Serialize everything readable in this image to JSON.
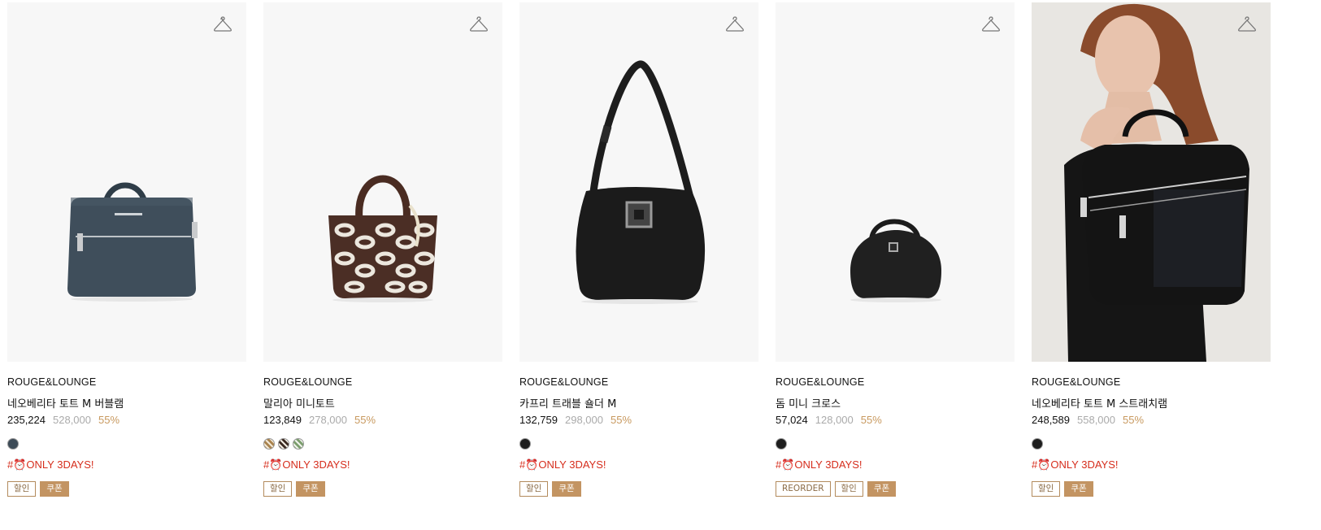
{
  "products": [
    {
      "brand": "ROUGE&LOUNGE",
      "name": "네오베리타 토트 M 버블램",
      "sale_price": "235,224",
      "original_price": "528,000",
      "discount": "55%",
      "swatch_colors": [
        "#3d4b57"
      ],
      "promo": "#⏰ONLY 3DAYS!",
      "tags": [
        {
          "label": "할인",
          "type": "discount"
        },
        {
          "label": "쿠폰",
          "type": "coupon"
        }
      ],
      "image": "navy-pebbled-leather-tote"
    },
    {
      "brand": "ROUGE&LOUNGE",
      "name": "말리아 미니토트",
      "sale_price": "123,849",
      "original_price": "278,000",
      "discount": "55%",
      "swatch_colors": [
        "#a9834e",
        "#3b2a22",
        "#7c9e6e"
      ],
      "promo": "#⏰ONLY 3DAYS!",
      "tags": [
        {
          "label": "할인",
          "type": "discount"
        },
        {
          "label": "쿠폰",
          "type": "coupon"
        }
      ],
      "image": "brown-chain-pattern-mini-tote"
    },
    {
      "brand": "ROUGE&LOUNGE",
      "name": "카프리 트래블 숄더 M",
      "sale_price": "132,759",
      "original_price": "298,000",
      "discount": "55%",
      "swatch_colors": [
        "#1e1e1e"
      ],
      "promo": "#⏰ONLY 3DAYS!",
      "tags": [
        {
          "label": "할인",
          "type": "discount"
        },
        {
          "label": "쿠폰",
          "type": "coupon"
        }
      ],
      "image": "black-nylon-shoulder-bag"
    },
    {
      "brand": "ROUGE&LOUNGE",
      "name": "돔 미니 크로스",
      "sale_price": "57,024",
      "original_price": "128,000",
      "discount": "55%",
      "swatch_colors": [
        "#1e1e1e"
      ],
      "promo": "#⏰ONLY 3DAYS!",
      "tags": [
        {
          "label": "REORDER",
          "type": "reorder"
        },
        {
          "label": "할인",
          "type": "discount"
        },
        {
          "label": "쿠폰",
          "type": "coupon"
        }
      ],
      "image": "black-dome-mini-crossbody"
    },
    {
      "brand": "ROUGE&LOUNGE",
      "name": "네오베리타 토트 M 스트래치램",
      "sale_price": "248,589",
      "original_price": "558,000",
      "discount": "55%",
      "swatch_colors": [
        "#1e1e1e"
      ],
      "promo": "#⏰ONLY 3DAYS!",
      "tags": [
        {
          "label": "할인",
          "type": "discount"
        },
        {
          "label": "쿠폰",
          "type": "coupon"
        }
      ],
      "image": "model-holding-black-quilted-tote"
    }
  ],
  "icons": {
    "wishlist": "hanger-icon",
    "promo_clock": "alarm-clock-icon"
  },
  "colors": {
    "price_discount": "#c8995f",
    "price_original": "#aaaaaa",
    "promo_red": "#d62e1d",
    "coupon_bg": "#c39462"
  }
}
